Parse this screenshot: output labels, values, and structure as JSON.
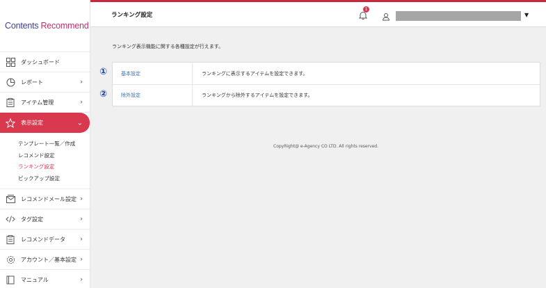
{
  "brand": {
    "word1": "Contents",
    "word2": "Recommend"
  },
  "sidebar": {
    "items": [
      {
        "label": "ダッシュボード",
        "icon": "dashboard-icon"
      },
      {
        "label": "レポート",
        "icon": "pie-chart-icon"
      },
      {
        "label": "アイテム管理",
        "icon": "clipboard-icon"
      },
      {
        "label": "表示設定",
        "icon": "star-icon"
      },
      {
        "label": "レコメンドメール設定",
        "icon": "mail-icon"
      },
      {
        "label": "タグ設定",
        "icon": "code-icon"
      },
      {
        "label": "レコメンドデータ",
        "icon": "clipboard-icon"
      },
      {
        "label": "アカウント／基本設定",
        "icon": "gear-icon"
      },
      {
        "label": "マニュアル",
        "icon": "book-icon"
      }
    ],
    "subitems": [
      {
        "label": "テンプレート一覧／作成"
      },
      {
        "label": "レコメンド設定"
      },
      {
        "label": "ランキング設定"
      },
      {
        "label": "ピックアップ設定"
      }
    ]
  },
  "header": {
    "title": "ランキング設定",
    "notification_count": "1",
    "dropdown_glyph": "▼"
  },
  "main": {
    "intro": "ランキング表示機能に関する各種設定が行えます。",
    "rows": [
      {
        "link": "基本設定",
        "desc": "ランキングに表示するアイテムを設定できます。"
      },
      {
        "link": "除外設定",
        "desc": "ランキングから除外するアイテムを設定できます。"
      }
    ],
    "markers": [
      "①",
      "②"
    ]
  },
  "footer": {
    "copyright": "CopyRight@ e-Agency CO LTD. All rights reserved."
  },
  "colors": {
    "accent": "#d9394e",
    "header_border": "#c6283d",
    "link": "#3a6fb0",
    "marker": "#1a3ba0"
  }
}
